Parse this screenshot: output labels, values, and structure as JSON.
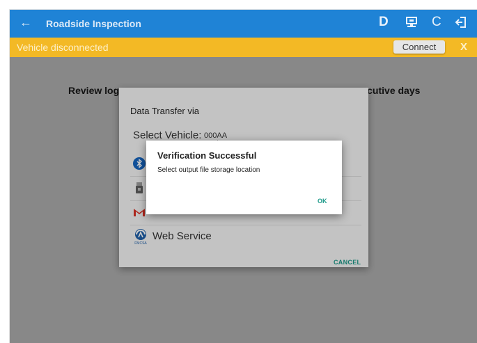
{
  "appbar": {
    "back_icon": "arrow-left-icon",
    "title": "Roadside Inspection",
    "actions": [
      {
        "name": "d-icon",
        "glyph": "D"
      },
      {
        "name": "transfer-monitor-icon",
        "glyph": ""
      },
      {
        "name": "refresh-icon",
        "glyph": "C"
      },
      {
        "name": "logout-icon",
        "glyph": ""
      }
    ],
    "color": "#1f83d6"
  },
  "banner": {
    "message": "Vehicle disconnected",
    "connect_label": "Connect",
    "close_label": "X",
    "color": "#f3b925"
  },
  "main": {
    "review_text_left": "Review log",
    "review_text_right": "cutive days"
  },
  "transfer_dialog": {
    "title": "Data Transfer via",
    "select_label": "Select Vehicle:",
    "select_value": "000AA",
    "options": [
      {
        "icon": "bluetooth-icon"
      },
      {
        "icon": "usb-drive-icon"
      },
      {
        "icon": "gmail-icon"
      }
    ],
    "web_service_label": "Web Service",
    "web_service_icon": "fmcsa-icon",
    "cancel_label": "CANCEL",
    "accent": "#1e9a8a"
  },
  "verify_dialog": {
    "title": "Verification Successful",
    "subtitle": "Select output file storage location",
    "ok_label": "OK"
  }
}
